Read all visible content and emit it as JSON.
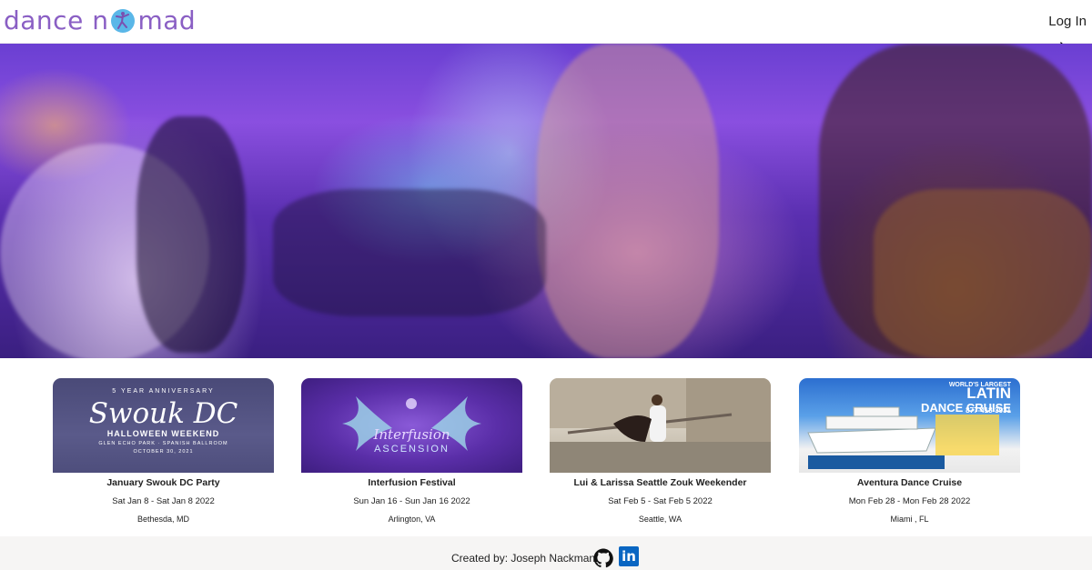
{
  "nav": {
    "logo_part1": "dance n",
    "logo_part2": "mad",
    "login_label": "Log In"
  },
  "hero": {
    "image_alt": "hero-photo"
  },
  "events": [
    {
      "title": "January Swouk DC Party",
      "date": "Sat Jan 8 - Sat Jan 8 2022",
      "location": "Bethesda, MD",
      "image": {
        "line1": "5 YEAR ANNIVERSARY",
        "line2": "Swouk DC",
        "line3": "HALLOWEEN WEEKEND",
        "line4": "GLEN ECHO PARK · SPANISH BALLROOM",
        "line5": "OCTOBER 30, 2021"
      }
    },
    {
      "title": "Interfusion Festival",
      "date": "Sun Jan 16 - Sun Jan 16 2022",
      "location": "Arlington, VA",
      "image": {
        "line1": "Interfusion",
        "line2": "ASCENSION"
      }
    },
    {
      "title": "Lui & Larissa Seattle Zouk Weekender",
      "date": "Sat Feb 5 - Sat Feb 5 2022",
      "location": "Seattle, WA",
      "image": {}
    },
    {
      "title": "Aventura Dance Cruise",
      "date": "Mon Feb 28 - Mon Feb 28 2022",
      "location": "Miami , FL",
      "image": {
        "line1": "WORLD'S LARGEST",
        "line2": "LATIN",
        "line3": "DANCE CRUISE",
        "line4": "877-418-3931"
      }
    }
  ],
  "footer": {
    "text": "Created by: Joseph Nackman",
    "linkedin_label": "in"
  },
  "colors": {
    "brand": "#8a5fc4",
    "linkedin": "#0a66c2"
  }
}
